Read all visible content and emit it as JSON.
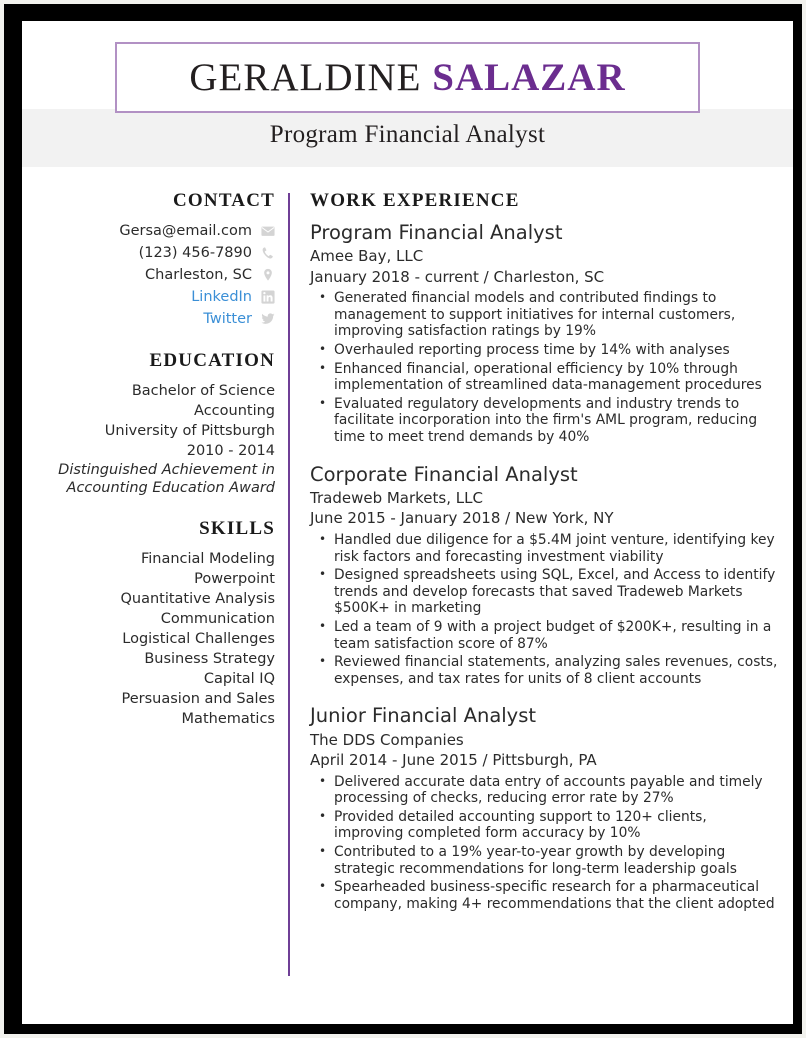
{
  "header": {
    "name_first": "GERALDINE ",
    "name_last": "SALAZAR",
    "job_title": "Program Financial Analyst",
    "accent_color": "#6B2D8F",
    "box_border_color": "#b291c4",
    "band_color": "#f2f2f2"
  },
  "sidebar": {
    "contact": {
      "heading": "CONTACT",
      "items": [
        {
          "text": "Gersa@email.com",
          "icon": "envelope-icon",
          "is_link": false
        },
        {
          "text": "(123) 456-7890",
          "icon": "phone-icon",
          "is_link": false
        },
        {
          "text": "Charleston, SC",
          "icon": "location-pin-icon",
          "is_link": false
        },
        {
          "text": "LinkedIn",
          "icon": "linkedin-icon",
          "is_link": true
        },
        {
          "text": "Twitter",
          "icon": "twitter-icon",
          "is_link": true
        }
      ]
    },
    "education": {
      "heading": "EDUCATION",
      "lines": [
        {
          "text": "Bachelor of Science",
          "italic": false
        },
        {
          "text": "Accounting",
          "italic": false
        },
        {
          "text": "University of Pittsburgh",
          "italic": false
        },
        {
          "text": "2010 - 2014",
          "italic": false
        },
        {
          "text": "Distinguished Achievement in",
          "italic": true
        },
        {
          "text": "Accounting Education Award",
          "italic": true
        }
      ]
    },
    "skills": {
      "heading": "SKILLS",
      "items": [
        "Financial Modeling",
        "Powerpoint",
        "Quantitative Analysis",
        "Communication",
        "Logistical Challenges",
        "Business Strategy",
        "Capital IQ",
        "Persuasion and Sales",
        "Mathematics"
      ]
    }
  },
  "main": {
    "heading": "WORK EXPERIENCE",
    "jobs": [
      {
        "role": "Program Financial Analyst",
        "company": "Amee Bay, LLC",
        "meta": "January 2018 - current  /  Charleston, SC",
        "bullets": [
          "Generated financial models and contributed findings to management to support initiatives for internal customers, improving satisfaction ratings by 19%",
          "Overhauled reporting process time by 14% with analyses",
          "Enhanced financial, operational efficiency by 10% through implementation of streamlined data-management procedures",
          "Evaluated regulatory developments and industry trends to facilitate incorporation into the firm's AML program, reducing time to meet trend demands by 40%"
        ]
      },
      {
        "role": "Corporate Financial Analyst",
        "company": "Tradeweb Markets, LLC",
        "meta": "June 2015 - January 2018  /  New York, NY",
        "bullets": [
          "Handled due diligence for a $5.4M joint venture, identifying key risk factors and forecasting investment viability",
          "Designed spreadsheets using SQL, Excel, and Access to identify trends and develop forecasts that saved Tradeweb Markets $500K+ in marketing",
          "Led a team of 9 with a project budget of $200K+, resulting in a team satisfaction score of 87%",
          "Reviewed financial statements, analyzing sales revenues, costs, expenses, and tax rates for units of 8 client accounts"
        ]
      },
      {
        "role": "Junior Financial Analyst",
        "company": "The DDS Companies",
        "meta": "April 2014 - June 2015  /  Pittsburgh, PA",
        "bullets": [
          "Delivered accurate data entry of accounts payable and timely processing of checks, reducing error rate by 27%",
          "Provided detailed accounting support to 120+ clients, improving completed form accuracy by 10%",
          "Contributed to a 19% year-to-year growth by developing strategic recommendations for long-term leadership goals",
          "Spearheaded business-specific research for a pharmaceutical company, making 4+ recommendations that the client adopted"
        ]
      }
    ]
  }
}
